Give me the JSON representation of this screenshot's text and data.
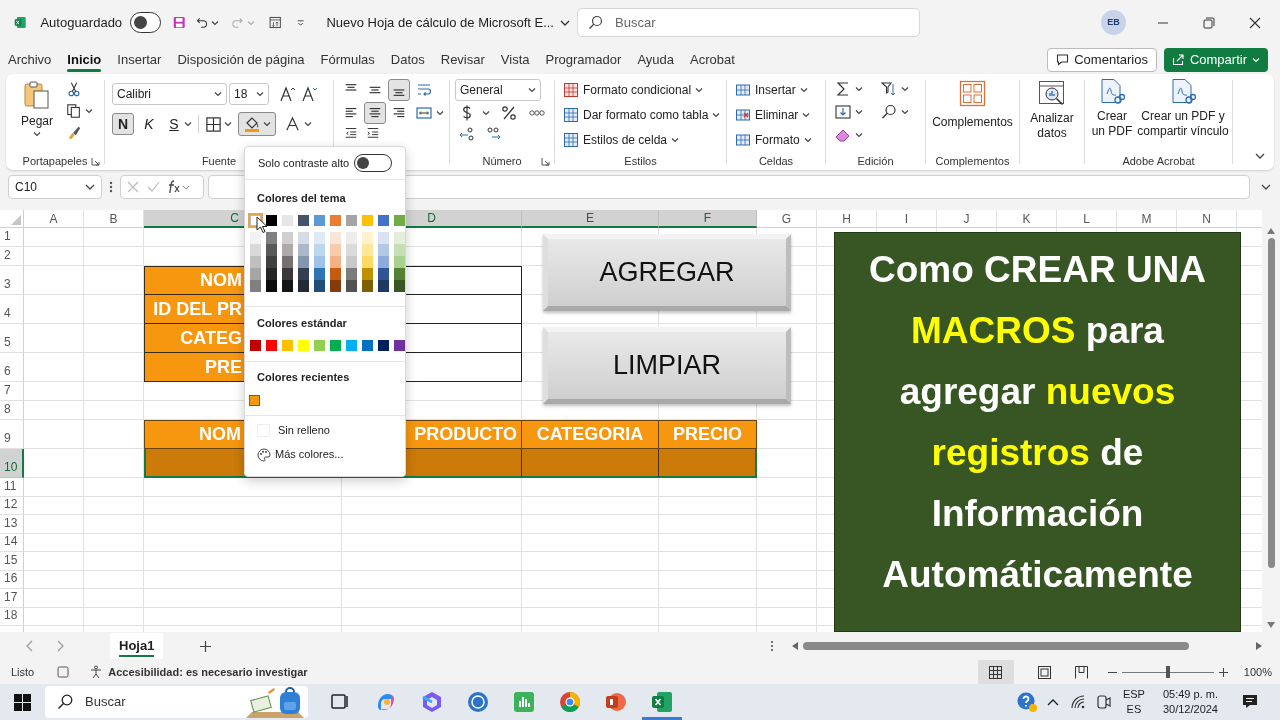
{
  "title_bar": {
    "autosave_label": "Autoguardado",
    "autosave_on": false,
    "document_title": "Nuevo Hoja de cálculo de Microsoft E...",
    "search_placeholder": "Buscar",
    "avatar": "EB"
  },
  "menu_tabs": [
    {
      "label": "Archivo",
      "selected": false
    },
    {
      "label": "Inicio",
      "selected": true
    },
    {
      "label": "Insertar",
      "selected": false
    },
    {
      "label": "Disposición de página",
      "selected": false
    },
    {
      "label": "Fórmulas",
      "selected": false
    },
    {
      "label": "Datos",
      "selected": false
    },
    {
      "label": "Revisar",
      "selected": false
    },
    {
      "label": "Vista",
      "selected": false
    },
    {
      "label": "Programador",
      "selected": false
    },
    {
      "label": "Ayuda",
      "selected": false
    },
    {
      "label": "Acrobat",
      "selected": false
    }
  ],
  "comments_button": "Comentarios",
  "share_button": "Compartir",
  "ribbon": {
    "portapapeles": {
      "paste": "Pegar",
      "label": "Portapapeles"
    },
    "fuente": {
      "font": "Calibri",
      "size": "18",
      "bold": {
        "label": "N",
        "on": true
      },
      "italic": "K",
      "underline": "S",
      "fill_expanded": true,
      "label": "Fuente"
    },
    "alineacion": {
      "vertical_buttons": [
        {
          "selected": false
        },
        {
          "selected": false
        },
        {
          "selected": true
        }
      ],
      "horizontal_buttons": [
        {
          "selected": false
        },
        {
          "selected": true
        },
        {
          "selected": false
        }
      ]
    },
    "numero": {
      "format": "General",
      "label": "Número"
    },
    "estilos": {
      "items": [
        "Formato condicional",
        "Dar formato como tabla",
        "Estilos de celda"
      ],
      "label": "Estilos"
    },
    "celdas": {
      "items": [
        "Insertar",
        "Eliminar",
        "Formato"
      ],
      "label": "Celdas"
    },
    "edicion": {
      "label": "Edición"
    },
    "complementos": {
      "button": "Complementos",
      "label": "Complementos"
    },
    "analizar": {
      "button": "Analizar datos"
    },
    "acrobat": {
      "buttons": [
        "Crear un PDF",
        "Crear un PDF y compartir vínculo"
      ],
      "label": "Adobe Acrobat"
    }
  },
  "formula_bar": {
    "name_box": "C10"
  },
  "sheet": {
    "columns": [
      {
        "label": "A",
        "selected": false
      },
      {
        "label": "B",
        "selected": false
      },
      {
        "label": "C",
        "selected": true
      },
      {
        "label": "D",
        "selected": true
      },
      {
        "label": "E",
        "selected": true
      },
      {
        "label": "F",
        "selected": true
      },
      {
        "label": "G",
        "selected": false
      },
      {
        "label": "H",
        "selected": false
      },
      {
        "label": "I",
        "selected": false
      },
      {
        "label": "J",
        "selected": false
      },
      {
        "label": "K",
        "selected": false
      },
      {
        "label": "L",
        "selected": false
      },
      {
        "label": "M",
        "selected": false
      },
      {
        "label": "N",
        "selected": false
      }
    ],
    "rows": [
      {
        "label": "1",
        "selected": false
      },
      {
        "label": "2",
        "selected": false
      },
      {
        "label": "3",
        "selected": false
      },
      {
        "label": "4",
        "selected": false
      },
      {
        "label": "5",
        "selected": false
      },
      {
        "label": "6",
        "selected": false
      },
      {
        "label": "7",
        "selected": false
      },
      {
        "label": "8",
        "selected": false
      },
      {
        "label": "9",
        "selected": false
      },
      {
        "label": "10",
        "selected": true
      },
      {
        "label": "11",
        "selected": false
      },
      {
        "label": "12",
        "selected": false
      },
      {
        "label": "13",
        "selected": false
      },
      {
        "label": "14",
        "selected": false
      },
      {
        "label": "15",
        "selected": false
      },
      {
        "label": "16",
        "selected": false
      },
      {
        "label": "17",
        "selected": false
      },
      {
        "label": "18",
        "selected": false
      }
    ]
  },
  "form_labels": [
    "NOM",
    "ID DEL PR",
    "CATEG",
    "PRE"
  ],
  "table_headers": [
    "NOM",
    "PRODUCTO",
    "CATEGORIA",
    "PRECIO"
  ],
  "buttons": [
    "AGREGAR",
    "LIMPIAR"
  ],
  "banner": {
    "lines": [
      [
        {
          "text": "Como CREAR UNA",
          "highlight": false
        }
      ],
      [
        {
          "text": "MACROS",
          "highlight": true
        },
        {
          "text": " para",
          "highlight": false
        }
      ],
      [
        {
          "text": "agregar ",
          "highlight": false
        },
        {
          "text": "nuevos",
          "highlight": true
        }
      ],
      [
        {
          "text": "registros",
          "highlight": true
        },
        {
          "text": " de",
          "highlight": false
        }
      ],
      [
        {
          "text": "Información",
          "highlight": false
        }
      ],
      [
        {
          "text": "Automáticamente",
          "highlight": false
        }
      ]
    ]
  },
  "fill_menu": {
    "high_contrast_label": "Solo contraste alto",
    "high_contrast_on": false,
    "theme_title": "Colores del tema",
    "theme_colors": [
      {
        "color": "#ffffff",
        "selected": true,
        "shades": [
          {
            "color": "#f2f2f2"
          },
          {
            "color": "#d9d9d9"
          },
          {
            "color": "#bfbfbf"
          },
          {
            "color": "#a6a6a6"
          },
          {
            "color": "#808080"
          }
        ]
      },
      {
        "color": "#000000",
        "selected": false,
        "shades": [
          {
            "color": "#808080"
          },
          {
            "color": "#595959"
          },
          {
            "color": "#404040"
          },
          {
            "color": "#262626"
          },
          {
            "color": "#0d0d0d"
          }
        ]
      },
      {
        "color": "#e7e6e6",
        "selected": false,
        "shades": [
          {
            "color": "#d0cece"
          },
          {
            "color": "#aeaaaa"
          },
          {
            "color": "#757171"
          },
          {
            "color": "#3a3838"
          },
          {
            "color": "#171616"
          }
        ]
      },
      {
        "color": "#44546a",
        "selected": false,
        "shades": [
          {
            "color": "#d6dce4"
          },
          {
            "color": "#adb9ca"
          },
          {
            "color": "#8497b0"
          },
          {
            "color": "#333f4f"
          },
          {
            "color": "#222a35"
          }
        ]
      },
      {
        "color": "#5b9bd5",
        "selected": false,
        "shades": [
          {
            "color": "#deebf7"
          },
          {
            "color": "#bdd7ee"
          },
          {
            "color": "#9dc3e6"
          },
          {
            "color": "#2e75b6"
          },
          {
            "color": "#1f4e79"
          }
        ]
      },
      {
        "color": "#ed7d31",
        "selected": false,
        "shades": [
          {
            "color": "#fbe5d6"
          },
          {
            "color": "#f8cbad"
          },
          {
            "color": "#f4b183"
          },
          {
            "color": "#c55a11"
          },
          {
            "color": "#843c0c"
          }
        ]
      },
      {
        "color": "#a5a5a5",
        "selected": false,
        "shades": [
          {
            "color": "#ededed"
          },
          {
            "color": "#dbdbdb"
          },
          {
            "color": "#c9c9c9"
          },
          {
            "color": "#7b7b7b"
          },
          {
            "color": "#525252"
          }
        ]
      },
      {
        "color": "#ffc000",
        "selected": false,
        "shades": [
          {
            "color": "#fff2cc"
          },
          {
            "color": "#ffe699"
          },
          {
            "color": "#ffd966"
          },
          {
            "color": "#bf9000"
          },
          {
            "color": "#7f6000"
          }
        ]
      },
      {
        "color": "#4472c4",
        "selected": false,
        "shades": [
          {
            "color": "#dae3f3"
          },
          {
            "color": "#b4c7e7"
          },
          {
            "color": "#8faadc"
          },
          {
            "color": "#2f5597"
          },
          {
            "color": "#203864"
          }
        ]
      },
      {
        "color": "#70ad47",
        "selected": false,
        "shades": [
          {
            "color": "#e2f0d9"
          },
          {
            "color": "#c5e0b4"
          },
          {
            "color": "#a9d18e"
          },
          {
            "color": "#548235"
          },
          {
            "color": "#385723"
          }
        ]
      }
    ],
    "standard_title": "Colores estándar",
    "standard_colors": [
      {
        "color": "#c00000"
      },
      {
        "color": "#ff0000"
      },
      {
        "color": "#ffc000"
      },
      {
        "color": "#ffff00"
      },
      {
        "color": "#92d050"
      },
      {
        "color": "#00b050"
      },
      {
        "color": "#00b0f0"
      },
      {
        "color": "#0070c0"
      },
      {
        "color": "#002060"
      },
      {
        "color": "#7030a0"
      }
    ],
    "recent_title": "Colores recientes",
    "recent_colors": [
      {
        "color": "#f7960f"
      }
    ],
    "no_fill": "Sin relleno",
    "more_colors": "Más colores..."
  },
  "sheet_tabs": [
    {
      "label": "Hoja1",
      "selected": true
    }
  ],
  "status_bar": {
    "ready": "Listo",
    "accessibility": "Accesibilidad: es necesario investigar",
    "zoom": {
      "level": 0.5,
      "reading": "100%"
    }
  },
  "taskbar": {
    "search_placeholder": "Buscar",
    "language": "ESP",
    "layout": "ES",
    "time": "05:49 p. m.",
    "date": "30/12/2024"
  }
}
